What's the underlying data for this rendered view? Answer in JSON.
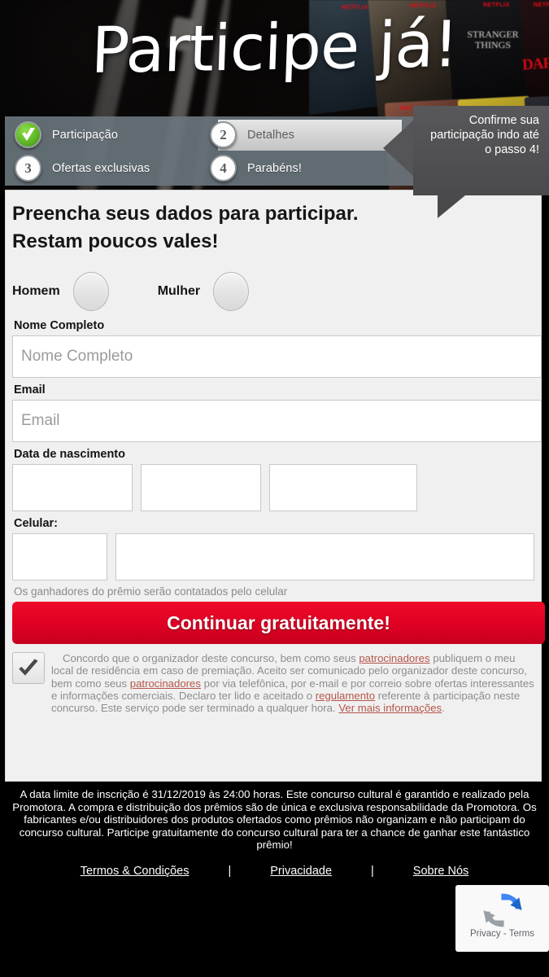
{
  "hero": {
    "title": "Participe já!"
  },
  "steps": {
    "items": [
      {
        "badge": "check-icon",
        "label": "Participação",
        "state": "done"
      },
      {
        "badge": "2",
        "label": "Detalhes",
        "state": "active"
      },
      {
        "badge": "3",
        "label": "Ofertas exclusivas",
        "state": "pending"
      },
      {
        "badge": "4",
        "label": "Parabéns!",
        "state": "pending"
      }
    ]
  },
  "tooltip": {
    "text": "Confirme sua participação indo até o passo 4!"
  },
  "form": {
    "headline_1": "Preencha seus dados para participar.",
    "headline_2": "Restam poucos vales!",
    "gender": {
      "male_label": "Homem",
      "female_label": "Mulher"
    },
    "name": {
      "label": "Nome Completo",
      "placeholder": "Nome Completo",
      "value": ""
    },
    "email": {
      "label": "Email",
      "placeholder": "Email",
      "value": ""
    },
    "birth": {
      "label": "Data de nascimento",
      "day": "",
      "month": "",
      "year": ""
    },
    "mobile": {
      "label": "Celular:",
      "ddd": "",
      "number": "",
      "hint": "Os ganhadores do prêmio serão contatados pelo celular"
    },
    "cta_label": "Continuar gratuitamente!",
    "consent": {
      "checked": true,
      "p1": "Concordo que o organizador deste concurso, bem como seus ",
      "link1": "patrocinadores",
      "p2": " publiquem o meu local de residência em caso de premiação. Aceito ser comunicado pelo organizador deste concurso, bem como seus ",
      "link2": "patrocinadores",
      "p3": " por via telefônica, por e-mail e por correio sobre ofertas interessantes e informações comerciais. Declaro ter lido e aceitado o ",
      "link3": "regulamento",
      "p4": " referente à participação neste concurso. Este serviço pode ser terminado a qualquer hora. ",
      "link4": "Ver mais informações",
      "p5": "."
    }
  },
  "footer": {
    "disclaimer": "A data limite de inscrição é 31/12/2019 às 24:00 horas. Este concurso cultural é garantido e realizado pela Promotora. A compra e distribuição dos prêmios são de única e exclusiva responsabilidade da Promotora. Os fabricantes e/ou distribuidores dos produtos ofertados como prêmios não organizam e não participam do concurso cultural. Participe gratuitamente do concurso cultural para ter a chance de ganhar este fantástico prêmio!",
    "links": [
      {
        "label": "Termos & Condições"
      },
      {
        "label": "Privacidade"
      },
      {
        "label": "Sobre Nós"
      }
    ],
    "separator": "|"
  },
  "recaptcha": {
    "label": "Privacy - Terms",
    "icon": "recaptcha-icon"
  },
  "colors": {
    "accent_red": "#dc0022",
    "step_bar": "#69747c",
    "panel": "#f0f0f0",
    "link": "#b4564a"
  },
  "background": {
    "netflix_wordmark": "NETFLIX",
    "poster_titles": [
      "STRANGER THINGS",
      "DAREDEVIL"
    ]
  }
}
